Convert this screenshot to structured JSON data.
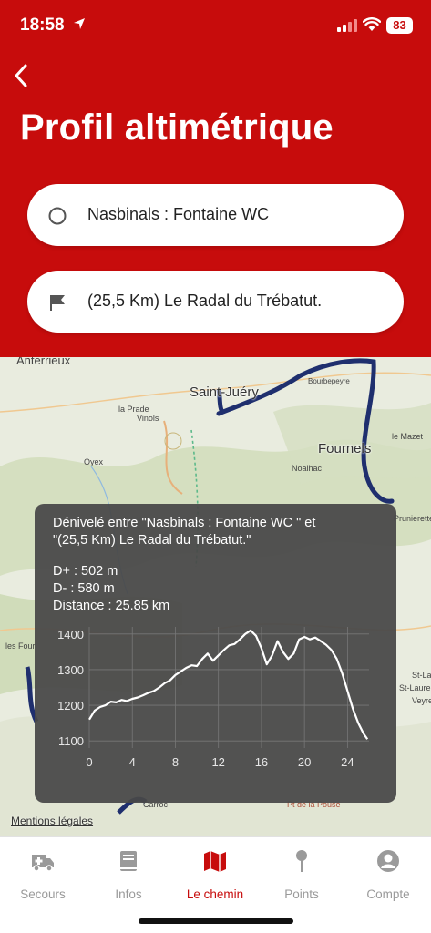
{
  "status_bar": {
    "time": "18:58",
    "battery": "83"
  },
  "header": {
    "title": "Profil altimétrique",
    "start_point": "Nasbinals : Fontaine WC",
    "end_point": "(25,5 Km) Le Radal du Trébatut."
  },
  "map": {
    "places": [
      "Anterrieux",
      "Saint-Juéry",
      "Fournels",
      "la Prade",
      "Vinols",
      "Oyex",
      "Noalhac",
      "Bourbepeyre",
      "le Mazet",
      "Prunierette",
      "Carroc",
      "St-Lau",
      "St-Laurent",
      "Veyre",
      "les Four",
      "Pt de la Pouse"
    ],
    "legal": "Mentions légales"
  },
  "overlay": {
    "desc_line1": "Dénivelé entre \"Nasbinals : Fontaine WC \" et",
    "desc_line2": "\"(25,5 Km) Le Radal du Trébatut.\"",
    "d_plus": "D+ : 502 m",
    "d_minus": "D- : 580 m",
    "distance": "Distance : 25.85 km"
  },
  "chart_data": {
    "type": "line",
    "title": "",
    "xlabel": "",
    "ylabel": "",
    "xlim": [
      0,
      26
    ],
    "ylim": [
      1080,
      1420
    ],
    "x_ticks": [
      0,
      4,
      8,
      12,
      16,
      20,
      24
    ],
    "y_ticks": [
      1100,
      1200,
      1300,
      1400
    ],
    "grid": true,
    "series": [
      {
        "x": [
          0,
          0.5,
          1,
          1.5,
          2,
          2.5,
          3,
          3.5,
          4,
          4.5,
          5,
          5.5,
          6,
          6.5,
          7,
          7.5,
          8,
          8.5,
          9,
          9.5,
          10,
          10.5,
          11,
          11.5,
          12,
          12.5,
          13,
          13.5,
          14,
          14.5,
          15,
          15.5,
          16,
          16.5,
          17,
          17.5,
          18,
          18.5,
          19,
          19.5,
          20,
          20.5,
          21,
          21.5,
          22,
          22.5,
          23,
          23.5,
          24,
          24.5,
          25,
          25.5,
          25.85
        ],
        "values": [
          1160,
          1185,
          1195,
          1200,
          1210,
          1208,
          1215,
          1212,
          1218,
          1222,
          1228,
          1235,
          1240,
          1250,
          1262,
          1270,
          1285,
          1295,
          1305,
          1312,
          1310,
          1330,
          1345,
          1325,
          1340,
          1355,
          1368,
          1372,
          1385,
          1400,
          1410,
          1395,
          1360,
          1315,
          1340,
          1380,
          1350,
          1330,
          1345,
          1385,
          1392,
          1385,
          1390,
          1380,
          1370,
          1355,
          1330,
          1290,
          1240,
          1190,
          1150,
          1120,
          1105
        ]
      }
    ]
  },
  "tabbar": {
    "tabs": [
      {
        "label": "Secours"
      },
      {
        "label": "Infos"
      },
      {
        "label": "Le chemin"
      },
      {
        "label": "Points"
      },
      {
        "label": "Compte"
      }
    ]
  }
}
